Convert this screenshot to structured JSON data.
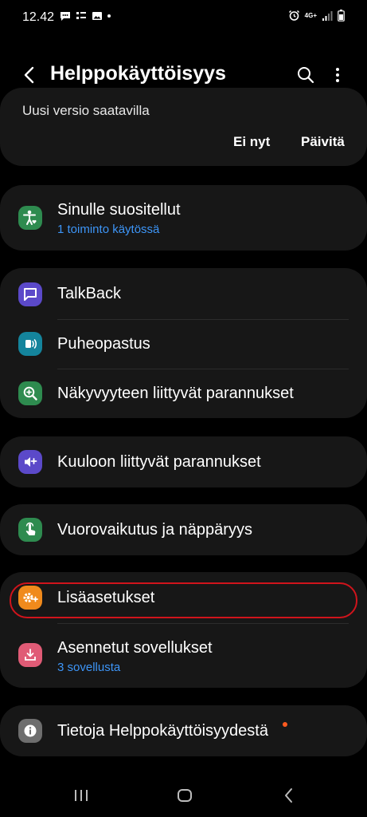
{
  "status_bar": {
    "time": "12.42",
    "network": "4G+"
  },
  "header": {
    "title": "Helppokäyttöisyys"
  },
  "update_card": {
    "text": "Uusi versio saatavilla",
    "later_label": "Ei nyt",
    "update_label": "Päivitä"
  },
  "recommended": {
    "title": "Sinulle suositellut",
    "subtitle": "1 toiminto käytössä"
  },
  "vision_group": {
    "items": [
      {
        "label": "TalkBack"
      },
      {
        "label": "Puheopastus"
      },
      {
        "label": "Näkyvyyteen liittyvät parannukset"
      }
    ]
  },
  "hearing": {
    "label": "Kuuloon liittyvät parannukset"
  },
  "interaction": {
    "label": "Vuorovaikutus ja näppäryys"
  },
  "advanced_group": {
    "advanced_label": "Lisäasetukset",
    "installed_title": "Asennetut sovellukset",
    "installed_subtitle": "3 sovellusta"
  },
  "about": {
    "label": "Tietoja Helppokäyttöisyydestä"
  },
  "colors": {
    "background": "#000000",
    "card": "#171717",
    "accent_blue": "#3d95f7",
    "highlight_red": "#d0141c",
    "icon_green": "#2e8b4f",
    "icon_purple": "#5b49c9",
    "icon_teal": "#14849c",
    "icon_orange": "#f08a1c",
    "icon_pink": "#e05b76",
    "icon_grey": "#6e6e6e",
    "badge_orange": "#ff5a1f"
  }
}
